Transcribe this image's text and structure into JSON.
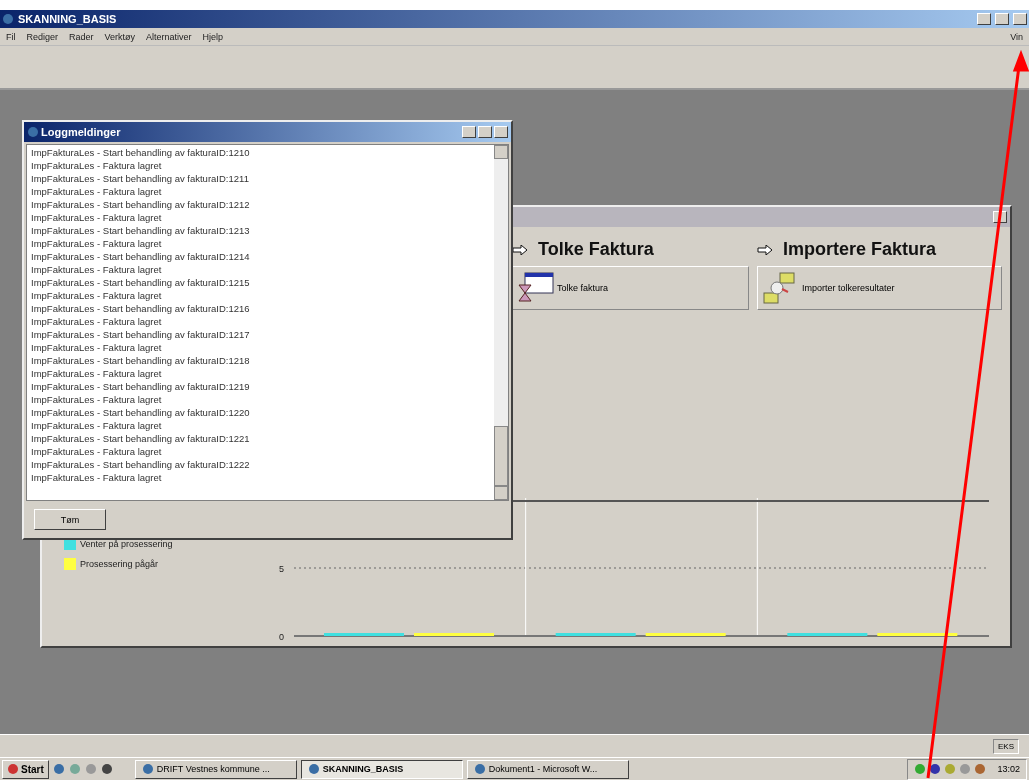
{
  "app_window": {
    "title": "SKANNING_BASIS",
    "menu": [
      "Fil",
      "Rediger",
      "Rader",
      "Verktøy",
      "Alternativer",
      "Hjelp"
    ],
    "menu_right": "Vin"
  },
  "invoice_window": {
    "steps": [
      {
        "heading": "Tolke Faktura",
        "button": "Tolke faktura",
        "kind": "interpret"
      },
      {
        "heading": "Importere Faktura",
        "button": "Importer tolkeresultater",
        "kind": "import"
      }
    ],
    "chart_data": {
      "type": "bar",
      "ylim": [
        0,
        10
      ],
      "yticks": [
        0,
        5
      ],
      "ref_lines": [
        {
          "axis": "y",
          "value": 5
        }
      ],
      "series": [
        {
          "name": "Venter på prosessering",
          "color": "#40e0e0",
          "values": [
            0,
            0,
            0
          ]
        },
        {
          "name": "Prosessering pågår",
          "color": "#ffff40",
          "values": [
            0,
            0,
            0
          ]
        }
      ]
    }
  },
  "log_window": {
    "title": "Loggmeldinger",
    "lines": [
      "ImpFakturaLes - Start behandling av fakturaID:1210",
      "ImpFakturaLes - Faktura lagret",
      "ImpFakturaLes - Start behandling av fakturaID:1211",
      "ImpFakturaLes - Faktura lagret",
      "ImpFakturaLes - Start behandling av fakturaID:1212",
      "ImpFakturaLes - Faktura lagret",
      "ImpFakturaLes - Start behandling av fakturaID:1213",
      "ImpFakturaLes - Faktura lagret",
      "ImpFakturaLes - Start behandling av fakturaID:1214",
      "ImpFakturaLes - Faktura lagret",
      "ImpFakturaLes - Start behandling av fakturaID:1215",
      "ImpFakturaLes - Faktura lagret",
      "ImpFakturaLes - Start behandling av fakturaID:1216",
      "ImpFakturaLes - Faktura lagret",
      "ImpFakturaLes - Start behandling av fakturaID:1217",
      "ImpFakturaLes - Faktura lagret",
      "ImpFakturaLes - Start behandling av fakturaID:1218",
      "ImpFakturaLes - Faktura lagret",
      "ImpFakturaLes - Start behandling av fakturaID:1219",
      "ImpFakturaLes - Faktura lagret",
      "ImpFakturaLes - Start behandling av fakturaID:1220",
      "ImpFakturaLes - Faktura lagret",
      "ImpFakturaLes - Start behandling av fakturaID:1221",
      "ImpFakturaLes - Faktura lagret",
      "ImpFakturaLes - Start behandling av fakturaID:1222",
      "ImpFakturaLes - Faktura lagret"
    ],
    "clear_button": "Tøm"
  },
  "status_bar": {
    "indicator": "EKS"
  },
  "taskbar": {
    "start": "Start",
    "tasks": [
      {
        "label": "DRIFT Vestnes kommune ...",
        "selected": false
      },
      {
        "label": "SKANNING_BASIS",
        "selected": true
      },
      {
        "label": "Dokument1 - Microsoft W...",
        "selected": false
      }
    ],
    "clock": "13:02"
  }
}
